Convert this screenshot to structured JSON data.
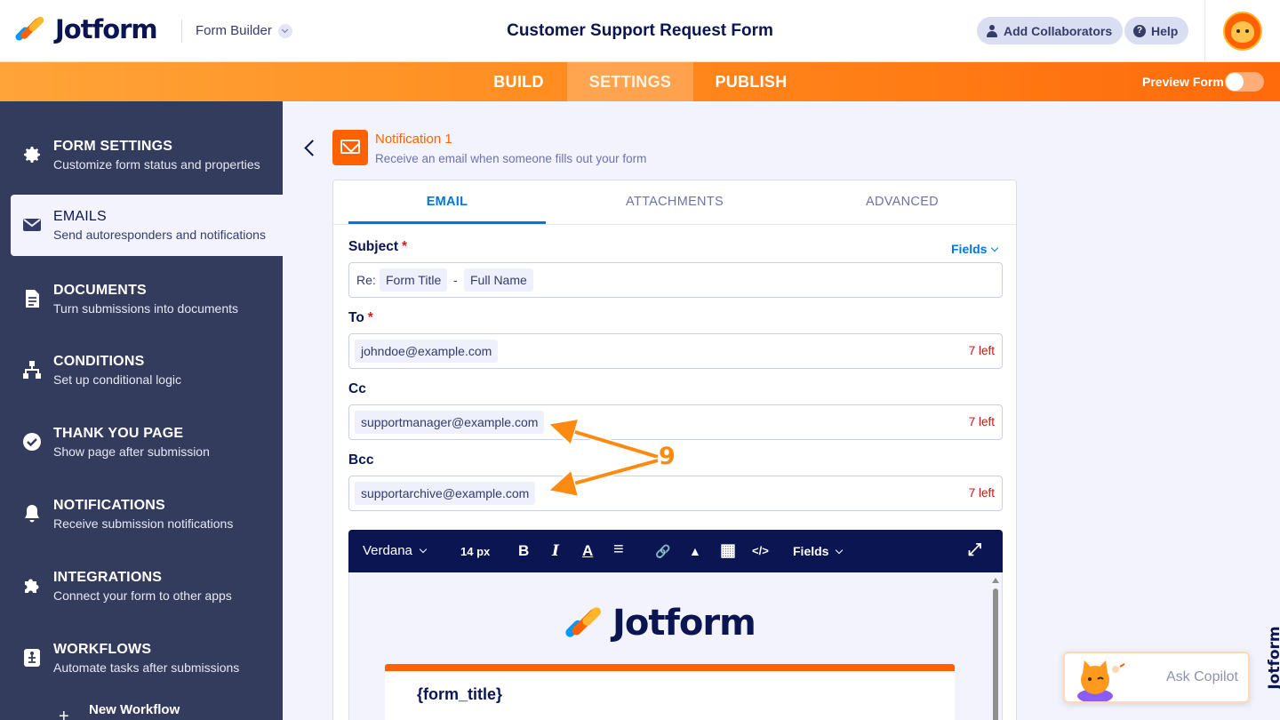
{
  "header": {
    "logo_text": "Jotform",
    "builder_label": "Form Builder",
    "form_title": "Customer Support Request Form",
    "add_collaborators": "Add Collaborators",
    "help": "Help",
    "help_icon_glyph": "?"
  },
  "tabs": {
    "items": [
      "BUILD",
      "SETTINGS",
      "PUBLISH"
    ],
    "active": "SETTINGS",
    "preview_label": "Preview Form",
    "preview_on": false
  },
  "sidebar": {
    "items": [
      {
        "title": "FORM SETTINGS",
        "subtitle": "Customize form status and properties",
        "icon": "gear-icon"
      },
      {
        "title": "EMAILS",
        "subtitle": "Send autoresponders and notifications",
        "icon": "envelope-icon"
      },
      {
        "title": "DOCUMENTS",
        "subtitle": "Turn submissions into documents",
        "icon": "document-icon"
      },
      {
        "title": "CONDITIONS",
        "subtitle": "Set up conditional logic",
        "icon": "conditions-icon"
      },
      {
        "title": "THANK YOU PAGE",
        "subtitle": "Show page after submission",
        "icon": "check-circle-icon"
      },
      {
        "title": "NOTIFICATIONS",
        "subtitle": "Receive submission notifications",
        "icon": "bell-icon"
      },
      {
        "title": "INTEGRATIONS",
        "subtitle": "Connect your form to other apps",
        "icon": "puzzle-icon"
      },
      {
        "title": "WORKFLOWS",
        "subtitle": "Automate tasks after submissions",
        "icon": "workflow-icon"
      }
    ],
    "active": "EMAILS",
    "new_workflow": "New Workflow",
    "plus_glyph": "+"
  },
  "notification": {
    "title": "Notification 1",
    "description": "Receive an email when someone fills out your form"
  },
  "email_tabs": [
    "EMAIL",
    "ATTACHMENTS",
    "ADVANCED"
  ],
  "email_tabs_active": "EMAIL",
  "form": {
    "subject": {
      "label": "Subject",
      "required_mark": "*",
      "fields_link": "Fields",
      "prefix": "Re:",
      "tokens": [
        "Form Title",
        "Full Name"
      ],
      "separator": "-"
    },
    "to": {
      "label": "To",
      "required_mark": "*",
      "value": "johndoe@example.com",
      "count": "7 left"
    },
    "cc": {
      "label": "Cc",
      "value": "supportmanager@example.com",
      "count": "7 left"
    },
    "bcc": {
      "label": "Bcc",
      "value": "supportarchive@example.com",
      "count": "7 left"
    }
  },
  "editor": {
    "font": "Verdana",
    "size": "14 px",
    "fields": "Fields",
    "tools": {
      "bold": "B",
      "italic": "I",
      "color": "A",
      "align": "≡",
      "link": "🔗",
      "image": "▲",
      "table": "▦",
      "code": "</>",
      "expand": "⤢"
    },
    "logo_text": "Jotform",
    "form_title_tag": "{form_title}"
  },
  "annotation": {
    "number": "9",
    "color": "#ff8a12"
  },
  "copilot": {
    "label": "Ask Copilot"
  },
  "brand_vertical": "Jotform",
  "colors": {
    "accent_orange": "#ff6100",
    "link_blue": "#0075e3",
    "navy": "#0a1551",
    "sidebar": "#343c5e"
  }
}
